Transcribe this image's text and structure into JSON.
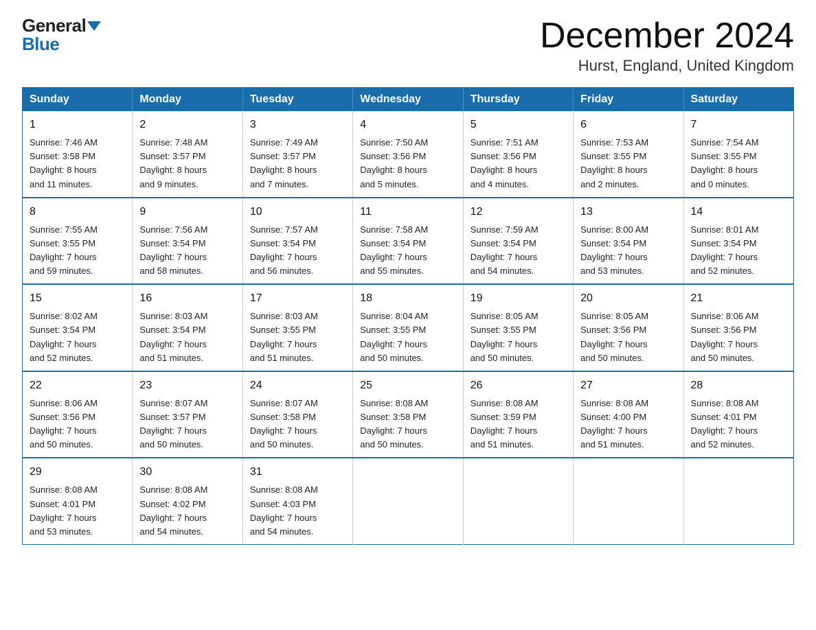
{
  "logo": {
    "general": "General",
    "blue": "Blue"
  },
  "title": "December 2024",
  "location": "Hurst, England, United Kingdom",
  "days_of_week": [
    "Sunday",
    "Monday",
    "Tuesday",
    "Wednesday",
    "Thursday",
    "Friday",
    "Saturday"
  ],
  "weeks": [
    [
      {
        "day": "1",
        "sunrise": "7:46 AM",
        "sunset": "3:58 PM",
        "daylight": "8 hours and 11 minutes."
      },
      {
        "day": "2",
        "sunrise": "7:48 AM",
        "sunset": "3:57 PM",
        "daylight": "8 hours and 9 minutes."
      },
      {
        "day": "3",
        "sunrise": "7:49 AM",
        "sunset": "3:57 PM",
        "daylight": "8 hours and 7 minutes."
      },
      {
        "day": "4",
        "sunrise": "7:50 AM",
        "sunset": "3:56 PM",
        "daylight": "8 hours and 5 minutes."
      },
      {
        "day": "5",
        "sunrise": "7:51 AM",
        "sunset": "3:56 PM",
        "daylight": "8 hours and 4 minutes."
      },
      {
        "day": "6",
        "sunrise": "7:53 AM",
        "sunset": "3:55 PM",
        "daylight": "8 hours and 2 minutes."
      },
      {
        "day": "7",
        "sunrise": "7:54 AM",
        "sunset": "3:55 PM",
        "daylight": "8 hours and 0 minutes."
      }
    ],
    [
      {
        "day": "8",
        "sunrise": "7:55 AM",
        "sunset": "3:55 PM",
        "daylight": "7 hours and 59 minutes."
      },
      {
        "day": "9",
        "sunrise": "7:56 AM",
        "sunset": "3:54 PM",
        "daylight": "7 hours and 58 minutes."
      },
      {
        "day": "10",
        "sunrise": "7:57 AM",
        "sunset": "3:54 PM",
        "daylight": "7 hours and 56 minutes."
      },
      {
        "day": "11",
        "sunrise": "7:58 AM",
        "sunset": "3:54 PM",
        "daylight": "7 hours and 55 minutes."
      },
      {
        "day": "12",
        "sunrise": "7:59 AM",
        "sunset": "3:54 PM",
        "daylight": "7 hours and 54 minutes."
      },
      {
        "day": "13",
        "sunrise": "8:00 AM",
        "sunset": "3:54 PM",
        "daylight": "7 hours and 53 minutes."
      },
      {
        "day": "14",
        "sunrise": "8:01 AM",
        "sunset": "3:54 PM",
        "daylight": "7 hours and 52 minutes."
      }
    ],
    [
      {
        "day": "15",
        "sunrise": "8:02 AM",
        "sunset": "3:54 PM",
        "daylight": "7 hours and 52 minutes."
      },
      {
        "day": "16",
        "sunrise": "8:03 AM",
        "sunset": "3:54 PM",
        "daylight": "7 hours and 51 minutes."
      },
      {
        "day": "17",
        "sunrise": "8:03 AM",
        "sunset": "3:55 PM",
        "daylight": "7 hours and 51 minutes."
      },
      {
        "day": "18",
        "sunrise": "8:04 AM",
        "sunset": "3:55 PM",
        "daylight": "7 hours and 50 minutes."
      },
      {
        "day": "19",
        "sunrise": "8:05 AM",
        "sunset": "3:55 PM",
        "daylight": "7 hours and 50 minutes."
      },
      {
        "day": "20",
        "sunrise": "8:05 AM",
        "sunset": "3:56 PM",
        "daylight": "7 hours and 50 minutes."
      },
      {
        "day": "21",
        "sunrise": "8:06 AM",
        "sunset": "3:56 PM",
        "daylight": "7 hours and 50 minutes."
      }
    ],
    [
      {
        "day": "22",
        "sunrise": "8:06 AM",
        "sunset": "3:56 PM",
        "daylight": "7 hours and 50 minutes."
      },
      {
        "day": "23",
        "sunrise": "8:07 AM",
        "sunset": "3:57 PM",
        "daylight": "7 hours and 50 minutes."
      },
      {
        "day": "24",
        "sunrise": "8:07 AM",
        "sunset": "3:58 PM",
        "daylight": "7 hours and 50 minutes."
      },
      {
        "day": "25",
        "sunrise": "8:08 AM",
        "sunset": "3:58 PM",
        "daylight": "7 hours and 50 minutes."
      },
      {
        "day": "26",
        "sunrise": "8:08 AM",
        "sunset": "3:59 PM",
        "daylight": "7 hours and 51 minutes."
      },
      {
        "day": "27",
        "sunrise": "8:08 AM",
        "sunset": "4:00 PM",
        "daylight": "7 hours and 51 minutes."
      },
      {
        "day": "28",
        "sunrise": "8:08 AM",
        "sunset": "4:01 PM",
        "daylight": "7 hours and 52 minutes."
      }
    ],
    [
      {
        "day": "29",
        "sunrise": "8:08 AM",
        "sunset": "4:01 PM",
        "daylight": "7 hours and 53 minutes."
      },
      {
        "day": "30",
        "sunrise": "8:08 AM",
        "sunset": "4:02 PM",
        "daylight": "7 hours and 54 minutes."
      },
      {
        "day": "31",
        "sunrise": "8:08 AM",
        "sunset": "4:03 PM",
        "daylight": "7 hours and 54 minutes."
      },
      null,
      null,
      null,
      null
    ]
  ],
  "sunrise_label": "Sunrise:",
  "sunset_label": "Sunset:",
  "daylight_label": "Daylight:"
}
